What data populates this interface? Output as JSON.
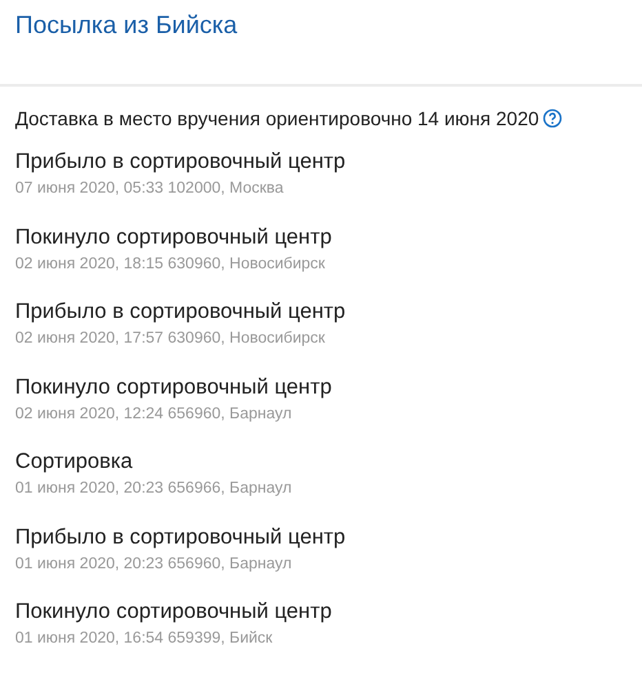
{
  "title": "Посылка из Бийска",
  "delivery": {
    "text": "Доставка в место вручения ориентировочно 14 июня 2020"
  },
  "events": [
    {
      "status": "Прибыло в сортировочный центр",
      "details": "07 июня 2020, 05:33 102000, Москва"
    },
    {
      "status": "Покинуло сортировочный центр",
      "details": "02 июня 2020, 18:15 630960, Новосибирск"
    },
    {
      "status": "Прибыло в сортировочный центр",
      "details": "02 июня 2020, 17:57 630960, Новосибирск"
    },
    {
      "status": "Покинуло сортировочный центр",
      "details": "02 июня 2020, 12:24 656960, Барнаул"
    },
    {
      "status": "Сортировка",
      "details": "01 июня 2020, 20:23 656966, Барнаул"
    },
    {
      "status": "Прибыло в сортировочный центр",
      "details": "01 июня 2020, 20:23 656960, Барнаул"
    },
    {
      "status": "Покинуло сортировочный центр",
      "details": "01 июня 2020, 16:54 659399, Бийск"
    }
  ]
}
